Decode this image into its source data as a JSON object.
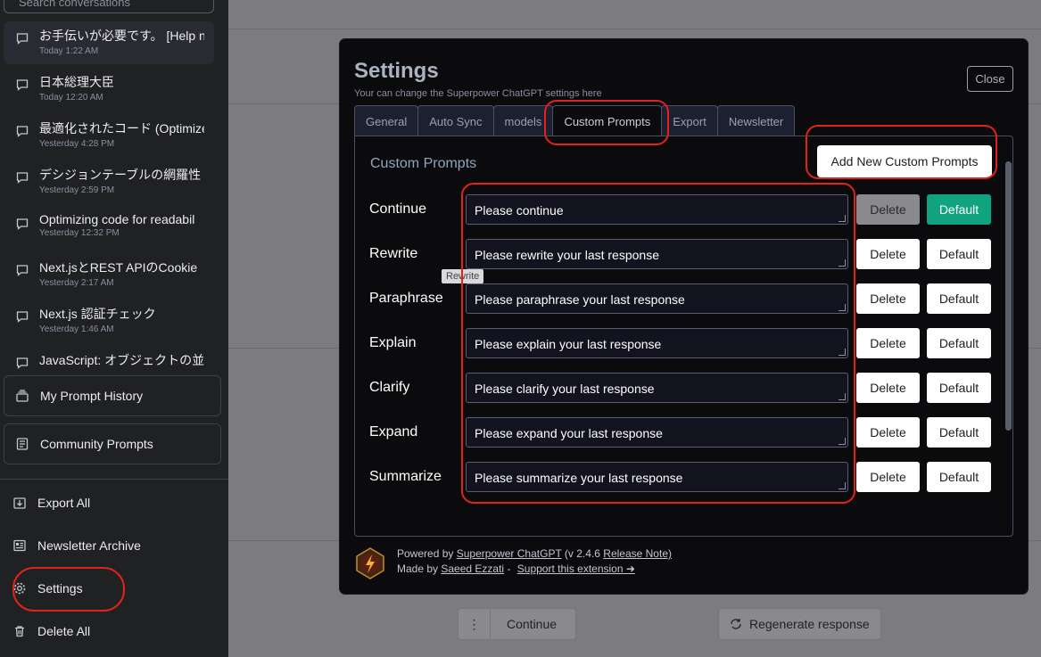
{
  "sidebar": {
    "search_placeholder": "Search conversations",
    "conversations": [
      {
        "title": "お手伝いが必要です。 [Help n",
        "date": "Today 1:22 AM"
      },
      {
        "title": "日本総理大臣",
        "date": "Today 12:20 AM"
      },
      {
        "title": "最適化されたコード (Optimize",
        "date": "Yesterday 4:28 PM"
      },
      {
        "title": "デシジョンテーブルの網羅性",
        "date": "Yesterday 2:59 PM"
      },
      {
        "title": "Optimizing code for readabil",
        "date": "Yesterday 12:32 PM"
      },
      {
        "title": "Next.jsとREST APIのCookie",
        "date": "Yesterday 2:17 AM"
      },
      {
        "title": "Next.js 認証チェック",
        "date": "Yesterday 1:46 AM"
      },
      {
        "title": "JavaScript: オブジェクトの並",
        "date": ""
      }
    ],
    "my_prompt_history": "My Prompt History",
    "community_prompts": "Community Prompts",
    "export_all": "Export All",
    "newsletter_archive": "Newsletter Archive",
    "settings": "Settings",
    "delete_all": "Delete All"
  },
  "background": {
    "continue_label": "Continue",
    "regenerate_label": "Regenerate response",
    "more_glyph": "⋮"
  },
  "modal": {
    "title": "Settings",
    "subtitle": "Your can change the Superpower ChatGPT settings here",
    "close_label": "Close",
    "tabs": [
      "General",
      "Auto Sync",
      "models",
      "Custom Prompts",
      "Export",
      "Newsletter"
    ],
    "active_tab": "Custom Prompts",
    "custom_prompts_heading": "Custom Prompts",
    "add_button": "Add New Custom Prompts",
    "delete_label": "Delete",
    "default_label": "Default",
    "prompts": [
      {
        "title": "Continue",
        "text": "Please continue",
        "is_default": true
      },
      {
        "title": "Rewrite",
        "text": "Please rewrite your last response",
        "is_default": false
      },
      {
        "title": "Paraphrase",
        "text": "Please paraphrase your last response",
        "is_default": false
      },
      {
        "title": "Explain",
        "text": "Please explain your last response",
        "is_default": false
      },
      {
        "title": "Clarify",
        "text": "Please clarify your last response",
        "is_default": false
      },
      {
        "title": "Expand",
        "text": "Please expand your last response",
        "is_default": false
      },
      {
        "title": "Summarize",
        "text": "Please summarize your last response",
        "is_default": false
      }
    ],
    "tooltip": "Rewrite",
    "footer": {
      "powered_by": "Powered by",
      "product_link": "Superpower ChatGPT",
      "version_open": "(v 2.4.6",
      "release_note": "Release Note)",
      "made_by": "Made by",
      "author": "Saeed Ezzati",
      "dash": "-",
      "support": "Support this extension ➜"
    }
  },
  "colors": {
    "modal_bg": "#0b0b0e",
    "sidebar_bg": "#202123",
    "default_primary": "#10a37f",
    "annotation_red": "#e0231b"
  }
}
